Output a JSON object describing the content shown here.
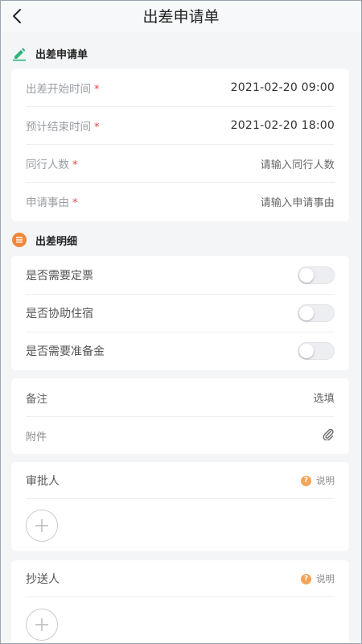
{
  "nav": {
    "title": "出差申请单"
  },
  "section_form": {
    "label": "出差申请单"
  },
  "form": {
    "start_label": "出差开始时间",
    "start_value": "2021-02-20 09:00",
    "end_label": "预计结束时间",
    "end_value": "2021-02-20 18:00",
    "companions_label": "同行人数",
    "companions_placeholder": "请输入同行人数",
    "reason_label": "申请事由",
    "reason_placeholder": "请输入申请事由",
    "required_mark": "*"
  },
  "section_detail": {
    "label": "出差明细"
  },
  "details": {
    "ticket_label": "是否需要定票",
    "ticket_on": false,
    "lodging_label": "是否协助住宿",
    "lodging_on": false,
    "reserve_label": "是否需要准备金",
    "reserve_on": false
  },
  "extra": {
    "remark_label": "备注",
    "remark_placeholder": "选填",
    "attach_label": "附件"
  },
  "approver": {
    "label": "审批人",
    "hint": "说明",
    "hint_icon": "?"
  },
  "cc": {
    "label": "抄送人",
    "hint": "说明",
    "hint_icon": "?"
  },
  "colors": {
    "accent_green": "#2fb47c",
    "accent_orange": "#f0883a",
    "required_red": "#e34747"
  }
}
